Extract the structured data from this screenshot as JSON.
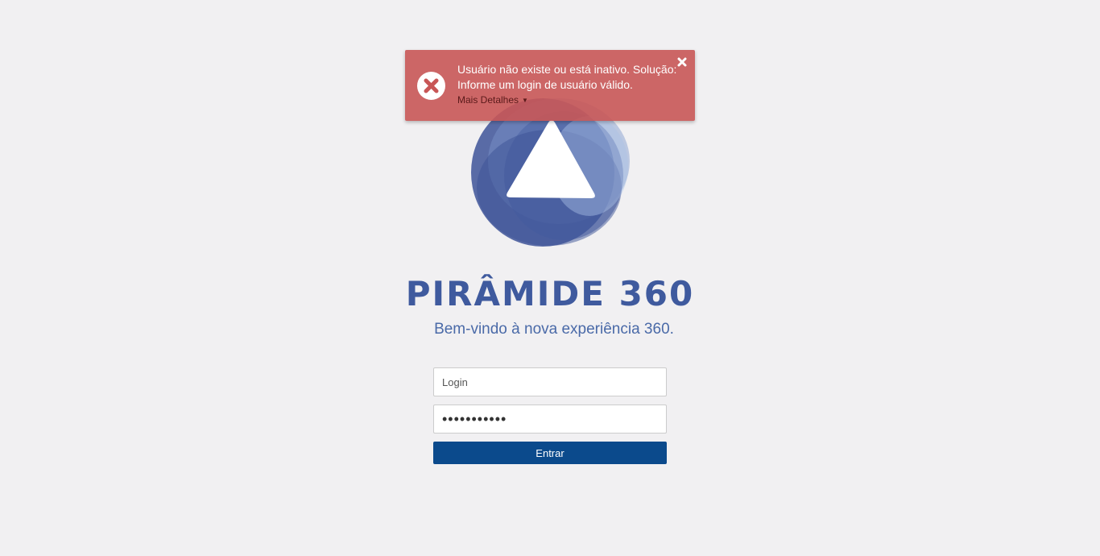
{
  "brand": {
    "title": "PIRÂMIDE 360",
    "subtitle": "Bem-vindo à nova experiência 360.",
    "color": "#3f5a9e"
  },
  "login_form": {
    "login_placeholder": "Login",
    "login_value": "",
    "password_value": "•••••••••••",
    "submit_label": "Entrar",
    "submit_color": "#0b4a8c"
  },
  "toast": {
    "type": "error",
    "message": "Usuário não existe ou está inativo. Solução: Informe um login de usuário válido.",
    "details_label": "Mais Detalhes",
    "details_icon": "caret-down-icon",
    "close_icon": "close-icon",
    "status_icon": "error-x-circle-icon",
    "background_color": "#c85656"
  },
  "logo": {
    "icon": "piramide-logo-icon"
  }
}
